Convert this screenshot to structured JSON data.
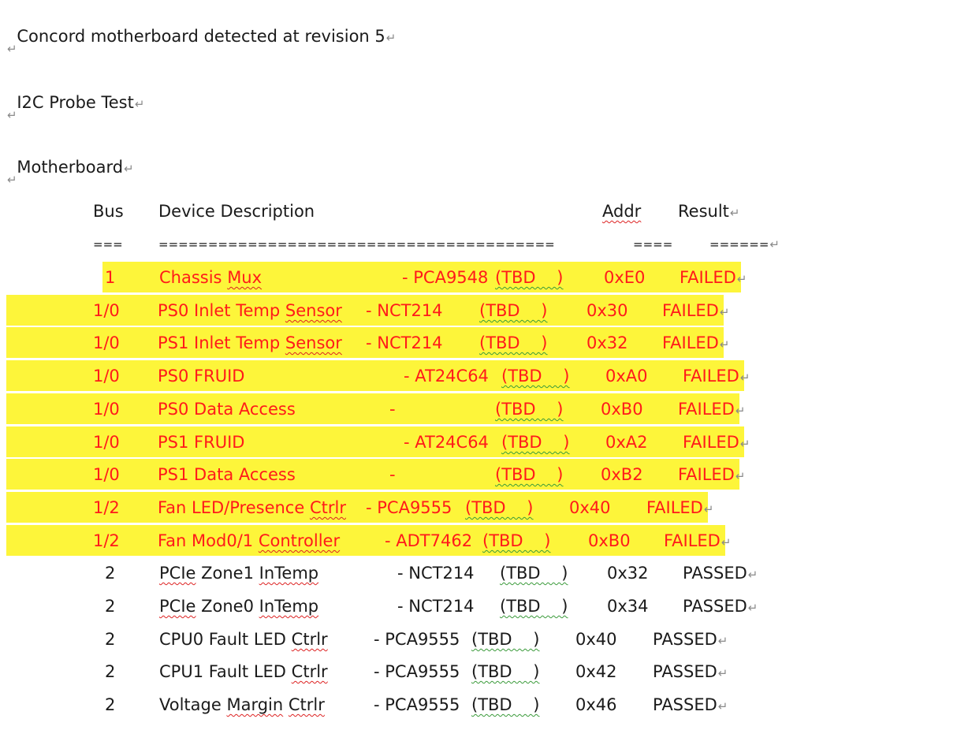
{
  "paragraphs": {
    "line1": "Concord motherboard detected at revision 5",
    "line2": "I2C Probe Test",
    "line3": "Motherboard"
  },
  "pilcrow": "↵",
  "header": {
    "bus": "Bus",
    "description": "Device Description",
    "addr": "Addr",
    "result": "Result"
  },
  "separator": {
    "bus": "===",
    "description": "========================================",
    "addr": "====",
    "result": "======"
  },
  "rows": [
    {
      "bus": "1",
      "name": "Chassis Mux",
      "part": "- PCA9548",
      "tbd": "(TBD    )",
      "addr": "0xE0",
      "result": "FAILED"
    },
    {
      "bus": "1/0",
      "name": "PS0 Inlet Temp Sensor",
      "part": "- NCT214",
      "tbd": "(TBD    )",
      "addr": "0x30",
      "result": "FAILED"
    },
    {
      "bus": "1/0",
      "name": "PS1 Inlet Temp Sensor",
      "part": "- NCT214",
      "tbd": "(TBD    )",
      "addr": "0x32",
      "result": "FAILED"
    },
    {
      "bus": "1/0",
      "name": "PS0 FRUID",
      "part": "- AT24C64",
      "tbd": "(TBD    )",
      "addr": "0xA0",
      "result": "FAILED"
    },
    {
      "bus": "1/0",
      "name": "PS0 Data Access",
      "part": "-",
      "tbd": "(TBD    )",
      "addr": "0xB0",
      "result": "FAILED"
    },
    {
      "bus": "1/0",
      "name": "PS1 FRUID",
      "part": "- AT24C64",
      "tbd": "(TBD    )",
      "addr": "0xA2",
      "result": "FAILED"
    },
    {
      "bus": "1/0",
      "name": "PS1 Data Access",
      "part": "-",
      "tbd": "(TBD    )",
      "addr": "0xB2",
      "result": "FAILED"
    },
    {
      "bus": "1/2",
      "name": "Fan LED/Presence Ctrlr",
      "part": "- PCA9555",
      "tbd": "(TBD    )",
      "addr": "0x40",
      "result": "FAILED"
    },
    {
      "bus": "1/2",
      "name": "Fan Mod0/1 Controller",
      "part": "- ADT7462",
      "tbd": "(TBD    )",
      "addr": "0xB0",
      "result": "FAILED"
    },
    {
      "bus": "2",
      "name": "PCIe Zone1 InTemp",
      "part": "- NCT214",
      "tbd": "(TBD    )",
      "addr": "0x32",
      "result": "PASSED"
    },
    {
      "bus": "2",
      "name": "PCIe Zone0 InTemp",
      "part": "- NCT214",
      "tbd": "(TBD    )",
      "addr": "0x34",
      "result": "PASSED"
    },
    {
      "bus": "2",
      "name": "CPU0 Fault LED Ctrlr",
      "part": "- PCA9555",
      "tbd": "(TBD    )",
      "addr": "0x40",
      "result": "PASSED"
    },
    {
      "bus": "2",
      "name": "CPU1 Fault LED Ctrlr",
      "part": "- PCA9555",
      "tbd": "(TBD    )",
      "addr": "0x42",
      "result": "PASSED"
    },
    {
      "bus": "2",
      "name": "Voltage Margin Ctrlr",
      "part": "- PCA9555",
      "tbd": "(TBD    )",
      "addr": "0x46",
      "result": "PASSED"
    }
  ],
  "colors": {
    "highlight": "#fdf53a",
    "failed_text": "#ff1a1a",
    "passed_text": "#1a1a1a"
  }
}
